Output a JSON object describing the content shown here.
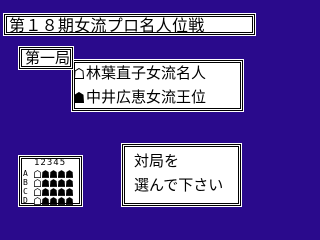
{
  "colors": {
    "background": "#2a0a8c",
    "panel": "#ffffff",
    "text": "#000000"
  },
  "title": "第１８期女流プロ名人位戦",
  "round": {
    "label": "第一局"
  },
  "players": [
    {
      "piece_icon": "white-shogi-piece-icon",
      "name": "林葉直子女流名人"
    },
    {
      "piece_icon": "black-shogi-piece-icon",
      "name": "中井広恵女流王位"
    }
  ],
  "game_grid": {
    "columns": [
      "1",
      "2",
      "3",
      "4",
      "5"
    ],
    "rows": [
      {
        "label": "A",
        "cells": [
          "white",
          "black",
          "black",
          "black",
          "black"
        ]
      },
      {
        "label": "B",
        "cells": [
          "white",
          "black",
          "black",
          "black",
          "black"
        ]
      },
      {
        "label": "C",
        "cells": [
          "white",
          "black",
          "black",
          "black",
          "black"
        ]
      },
      {
        "label": "D",
        "cells": [
          "white",
          "black",
          "black",
          "black",
          "black"
        ]
      }
    ]
  },
  "message": {
    "line1": "対局を",
    "line2": "選んで下さい"
  }
}
